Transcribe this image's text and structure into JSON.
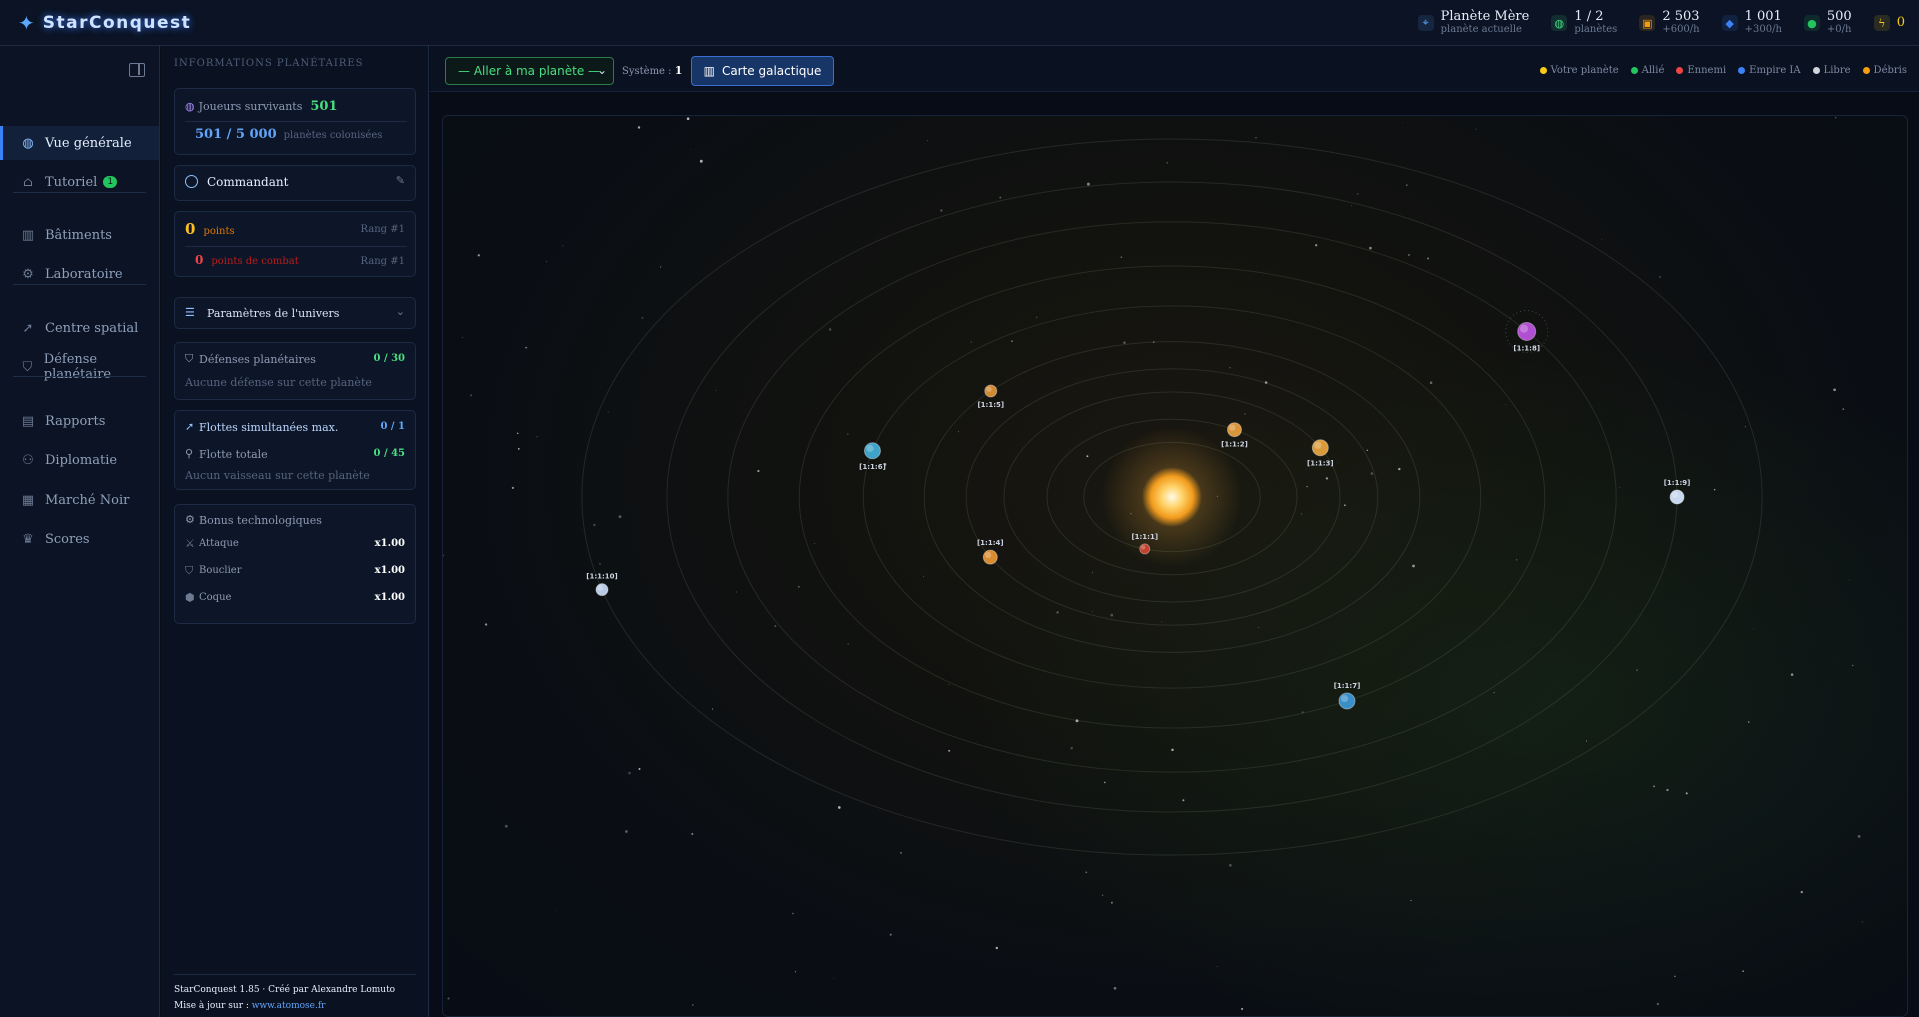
{
  "header": {
    "logo_icon": "rocket-icon",
    "title": "StarConquest",
    "resources": [
      {
        "name": "planet",
        "icon": "location-pin-icon",
        "value": "Planète Mère",
        "sub": "planète actuelle",
        "color": "#60a5fa"
      },
      {
        "name": "planets",
        "icon": "globe-icon",
        "value": "1 / 2",
        "sub": "planètes",
        "color": "#4ade80"
      },
      {
        "name": "metal",
        "icon": "cart-icon",
        "value": "2 503",
        "sub": "+600/h",
        "color": "#f59e0b"
      },
      {
        "name": "crystal",
        "icon": "diamond-icon",
        "value": "1 001",
        "sub": "+300/h",
        "color": "#3b82f6"
      },
      {
        "name": "deuterium",
        "icon": "droplet-icon",
        "value": "500",
        "sub": "+0/h",
        "color": "#22c55e"
      },
      {
        "name": "energy",
        "icon": "lightning-icon",
        "value": "0",
        "sub": "",
        "color": "#facc15"
      }
    ]
  },
  "sidebar": {
    "items": [
      {
        "label": "Vue générale",
        "icon": "globe-icon",
        "active": true
      },
      {
        "label": "Tutoriel",
        "icon": "graduation-cap-icon",
        "badge": "1"
      },
      {
        "label": "Bâtiments",
        "icon": "buildings-icon"
      },
      {
        "label": "Laboratoire",
        "icon": "cpu-icon"
      },
      {
        "label": "Centre spatial",
        "icon": "rocket-icon"
      },
      {
        "label": "Défense planétaire",
        "icon": "shield-icon"
      },
      {
        "label": "Rapports",
        "icon": "document-icon"
      },
      {
        "label": "Diplomatie",
        "icon": "users-icon"
      },
      {
        "label": "Marché Noir",
        "icon": "store-icon"
      },
      {
        "label": "Scores",
        "icon": "trophy-icon"
      }
    ]
  },
  "info": {
    "title": "INFORMATIONS PLANÉTAIRES",
    "survivors_label": "Joueurs survivants",
    "survivors_value": "501",
    "colonized_value": "501 / 5 000",
    "colonized_label": "planètes colonisées",
    "commander_label": "Commandant",
    "points_value": "0",
    "points_label": "points",
    "points_rank": "Rang #1",
    "combat_value": "0",
    "combat_label": "points de combat",
    "combat_rank": "Rang #1",
    "universe_label": "Paramètres de l'univers",
    "defenses_label": "Défenses planétaires",
    "defenses_value": "0 / 30",
    "defenses_empty": "Aucune défense sur cette planète",
    "fleets_label": "Flottes simultanées max.",
    "fleets_value": "0 / 1",
    "fleet_total_label": "Flotte totale",
    "fleet_total_value": "0 / 45",
    "fleet_empty": "Aucun vaisseau sur cette planète",
    "bonus_title": "Bonus technologiques",
    "bonus": [
      {
        "label": "Attaque",
        "value": "x1.00",
        "icon": "sword-icon"
      },
      {
        "label": "Bouclier",
        "value": "x1.00",
        "icon": "shield-icon"
      },
      {
        "label": "Coque",
        "value": "x1.00",
        "icon": "hexagon-icon"
      }
    ],
    "footer_line1": "StarConquest 1.85 · Créé par Alexandre Lomuto",
    "footer_prefix": "Mise à jour sur : ",
    "footer_link": "www.atomose.fr"
  },
  "main": {
    "goto_label": "— Aller à ma planète —",
    "system_label": "Système :",
    "system_value": "1",
    "galaxy_button": "Carte galactique",
    "legend": [
      {
        "label": "Votre planète",
        "color": "#facc15"
      },
      {
        "label": "Allié",
        "color": "#22c55e"
      },
      {
        "label": "Ennemi",
        "color": "#ef4444"
      },
      {
        "label": "Empire IA",
        "color": "#3b82f6"
      },
      {
        "label": "Libre",
        "color": "#d1d5db"
      },
      {
        "label": "Débris",
        "color": "#f59e0b"
      }
    ],
    "planets": [
      {
        "label": "[1:1:1]",
        "color": "#c2412c",
        "ring": 1
      },
      {
        "label": "[1:1:2]",
        "color": "#d9953a",
        "ring": 2
      },
      {
        "label": "[1:1:3]",
        "color": "#d99a3a",
        "ring": 3
      },
      {
        "label": "[1:1:4]",
        "color": "#d98b30",
        "ring": 4
      },
      {
        "label": "[1:1:5]",
        "color": "#d08a32",
        "ring": 5
      },
      {
        "label": "[1:1:6]",
        "color": "#3fa3c9",
        "ring": 6
      },
      {
        "label": "[1:1:7]",
        "color": "#3a8fc7",
        "ring": 7
      },
      {
        "label": "[1:1:8]",
        "color": "#b04fd1",
        "ring": 8
      },
      {
        "label": "[1:1:9]",
        "color": "#c8d8ee",
        "ring": 9
      },
      {
        "label": "[1:1:10]",
        "color": "#b9cbe4",
        "ring": 10
      }
    ]
  }
}
